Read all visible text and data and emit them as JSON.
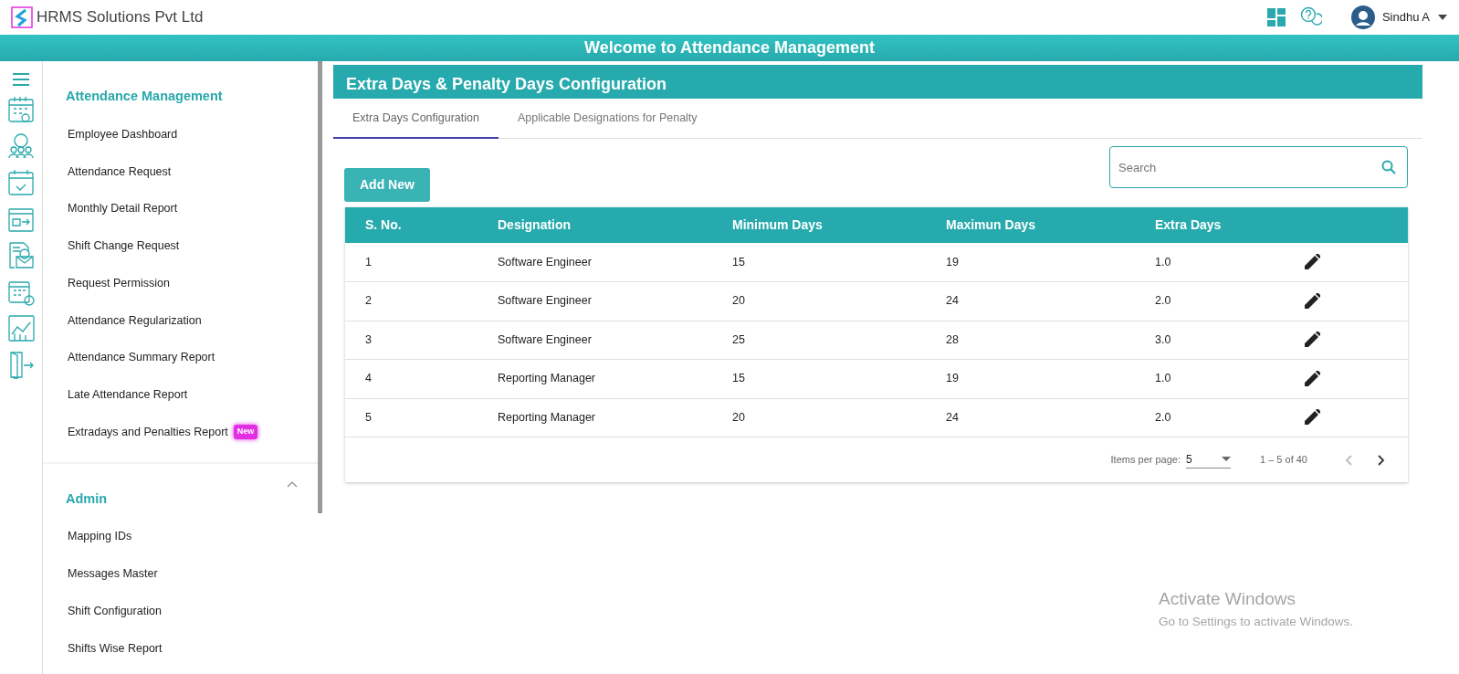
{
  "header": {
    "brand": "HRMS Solutions Pvt Ltd",
    "user": "Sindhu A"
  },
  "banner": "Welcome to Attendance Management",
  "sidebar": {
    "sections": [
      {
        "title": "Attendance Management",
        "items": [
          {
            "label": "Employee Dashboard"
          },
          {
            "label": "Attendance Request"
          },
          {
            "label": "Monthly Detail Report"
          },
          {
            "label": "Shift Change Request"
          },
          {
            "label": "Request Permission"
          },
          {
            "label": "Attendance Regularization"
          },
          {
            "label": "Attendance Summary Report"
          },
          {
            "label": "Late Attendance Report"
          },
          {
            "label": "Extradays and Penalties Report",
            "badge": "New"
          }
        ]
      },
      {
        "title": "Admin",
        "expanded": true,
        "items": [
          {
            "label": "Mapping IDs"
          },
          {
            "label": "Messages Master"
          },
          {
            "label": "Shift Configuration"
          },
          {
            "label": "Shifts Wise Report"
          }
        ]
      }
    ]
  },
  "page_title": "Extra Days & Penalty Days Configuration",
  "tabs": [
    {
      "label": "Extra Days Configuration",
      "selected": true
    },
    {
      "label": "Applicable Designations for Penalty",
      "selected": false
    }
  ],
  "add_button": "Add New",
  "search": {
    "placeholder": "Search"
  },
  "table": {
    "columns": [
      "S. No.",
      "Designation",
      "Minimum Days",
      "Maximun Days",
      "Extra Days"
    ],
    "rows": [
      [
        "1",
        "Software Engineer",
        "15",
        "19",
        "1.0"
      ],
      [
        "2",
        "Software Engineer",
        "20",
        "24",
        "2.0"
      ],
      [
        "3",
        "Software Engineer",
        "25",
        "28",
        "3.0"
      ],
      [
        "4",
        "Reporting Manager",
        "15",
        "19",
        "1.0"
      ],
      [
        "5",
        "Reporting Manager",
        "20",
        "24",
        "2.0"
      ]
    ]
  },
  "paginator": {
    "items_label": "Items per page:",
    "page_size": "5",
    "range": "1 – 5 of 40",
    "prev_disabled": true,
    "next_disabled": false
  },
  "os_notice": {
    "title": "Activate Windows",
    "subtitle": "Go to Settings to activate Windows."
  }
}
